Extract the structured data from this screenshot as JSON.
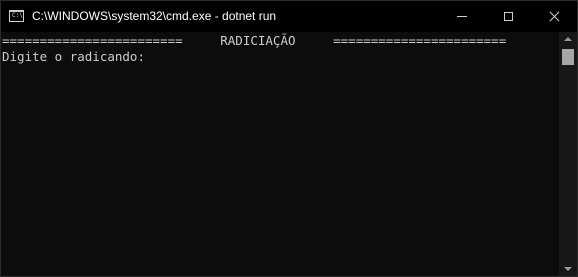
{
  "window": {
    "title": "C:\\WINDOWS\\system32\\cmd.exe - dotnet  run",
    "icon": "cmd-icon",
    "icon_text": "C:\\"
  },
  "caption_buttons": {
    "minimize_icon": "minimize-icon",
    "maximize_icon": "maximize-icon",
    "close_icon": "close-icon"
  },
  "console": {
    "lines": [
      "========================     RADICIAÇÃO     =======================",
      "Digite o radicando:"
    ],
    "foreground": "#cccccc",
    "background": "#0c0c0c"
  },
  "scrollbar": {
    "up_icon": "scroll-up-arrow-icon",
    "down_icon": "scroll-down-arrow-icon"
  }
}
